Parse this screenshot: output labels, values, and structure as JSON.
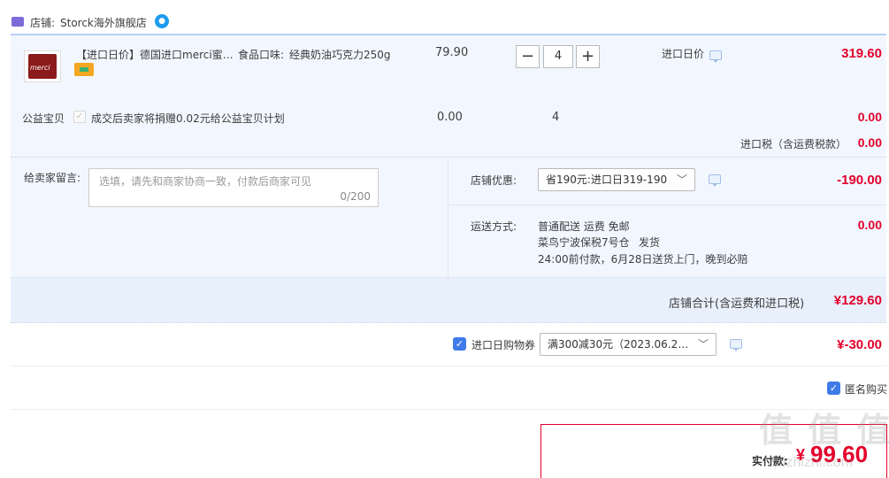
{
  "shop": {
    "label": "店铺:",
    "name": "Storck海外旗舰店"
  },
  "item": {
    "title": "【进口日价】德国进口merci蜜…",
    "flavor_label": "食品口味:",
    "flavor": "经典奶油巧克力250g",
    "price": "79.90",
    "qty": "4",
    "promo_tag": "进口日价",
    "total": "319.60"
  },
  "charity": {
    "label": "公益宝贝",
    "text": "成交后卖家将捐赠0.02元给公益宝贝计划",
    "price": "0.00",
    "qty": "4",
    "total": "0.00"
  },
  "tax": {
    "label": "进口税（含运费税款）",
    "value": "0.00"
  },
  "message": {
    "label": "给卖家留言:",
    "placeholder": "选填，请先和商家协商一致，付款后商家可见",
    "counter": "0/200"
  },
  "discount": {
    "label": "店铺优惠:",
    "selected": "省190元:进口日319-190",
    "value": "-190.00"
  },
  "shipping": {
    "label": "运送方式:",
    "line1": "普通配送 运费 免邮",
    "line2": "菜鸟宁波保税7号仓",
    "line2b": "发货",
    "line3": "24:00前付款，6月28日送货上门，晚到必赔",
    "value": "0.00"
  },
  "shop_total": {
    "label": "店铺合计(含运费和进口税)",
    "value": "¥129.60"
  },
  "coupon": {
    "label": "进口日购物券",
    "selected": "满300减30元（2023.06.2…",
    "value": "¥-30.00"
  },
  "anonymous": {
    "label": "匿名购买"
  },
  "payment": {
    "label": "实付款:",
    "value": "99.60"
  },
  "watermark": "值 值 值",
  "watermark_url": "zhizhizhi.com",
  "colors": {
    "accent_red": "#e4002b",
    "accent_blue": "#3f7be8",
    "panel_bg": "#f2f7ff"
  }
}
